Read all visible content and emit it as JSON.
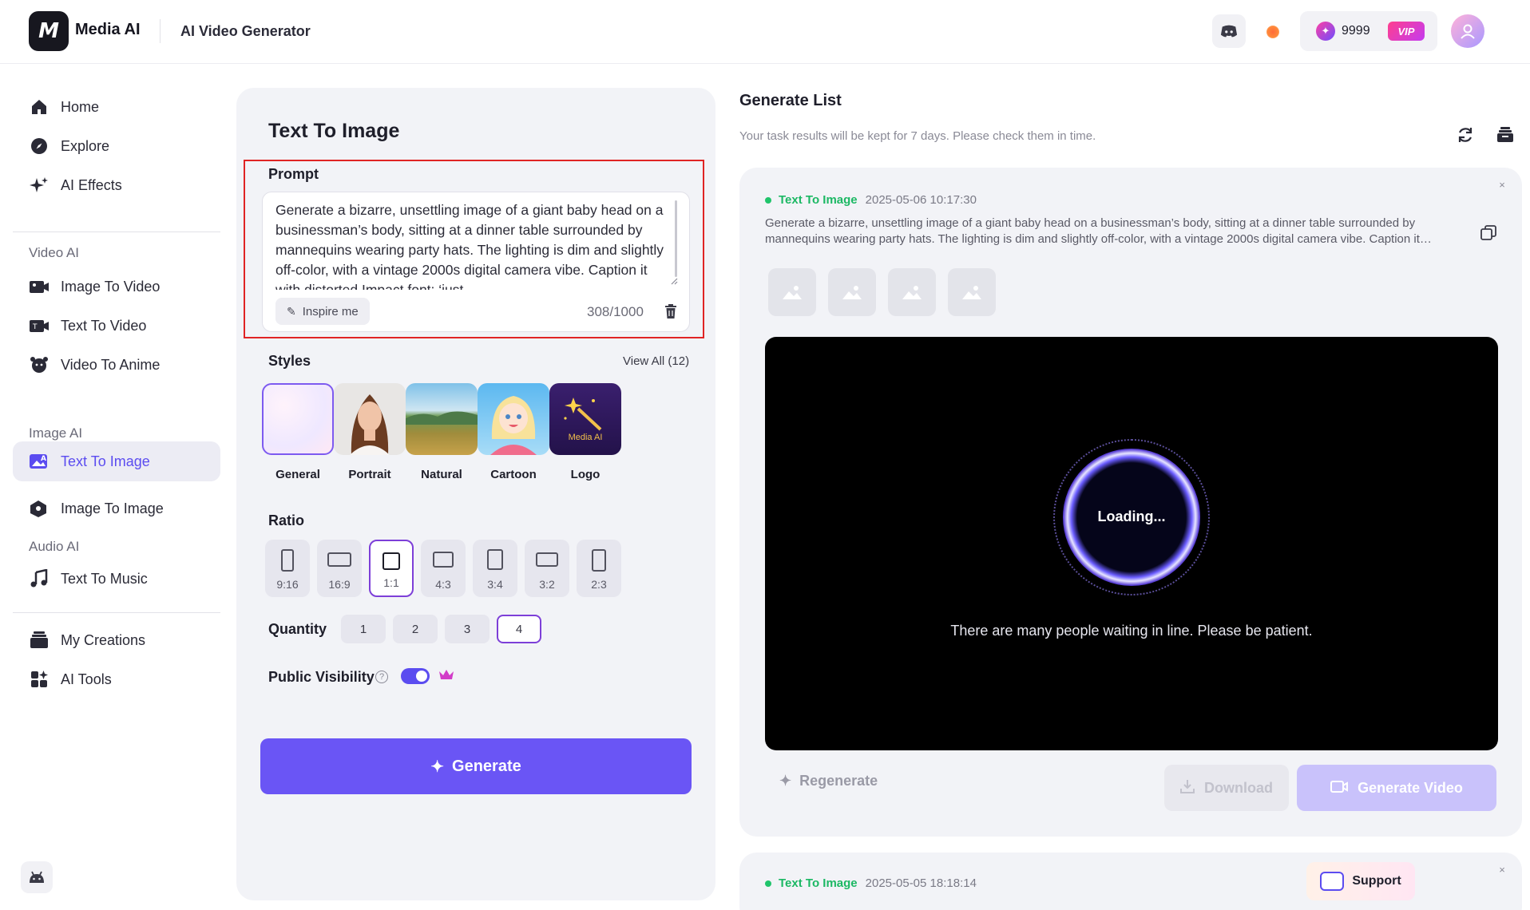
{
  "header": {
    "logo_glyph": "M",
    "brand": "Media AI",
    "title": "AI Video Generator",
    "credits": "9999",
    "vip_label": "VIP"
  },
  "sidebar": {
    "items_top": [
      {
        "label": "Home",
        "icon": "home-icon"
      },
      {
        "label": "Explore",
        "icon": "compass-icon"
      },
      {
        "label": "AI Effects",
        "icon": "sparkle-icon"
      }
    ],
    "section_video": "Video AI",
    "video_items": [
      {
        "label": "Image To Video",
        "icon": "image-video-icon"
      },
      {
        "label": "Text To Video",
        "icon": "text-video-icon"
      },
      {
        "label": "Video To Anime",
        "icon": "anime-icon"
      }
    ],
    "section_image": "Image AI",
    "image_items": [
      {
        "label": "Text To Image",
        "icon": "text-image-icon",
        "active": true
      },
      {
        "label": "Image To Image",
        "icon": "image-image-icon"
      }
    ],
    "section_audio": "Audio AI",
    "audio_items": [
      {
        "label": "Text To Music",
        "icon": "music-icon"
      }
    ],
    "items_bottom": [
      {
        "label": "My Creations",
        "icon": "creations-icon"
      },
      {
        "label": "AI Tools",
        "icon": "tools-icon"
      }
    ]
  },
  "form": {
    "title": "Text To Image",
    "prompt_label": "Prompt",
    "prompt_value": "Generate a bizarre, unsettling image of a giant baby head on a businessman’s body, sitting at a dinner table surrounded by mannequins wearing party hats. The lighting is dim and slightly off-color, with a vintage 2000s digital camera vibe. Caption it with distorted Impact font: ‘just",
    "inspire_label": "Inspire me",
    "char_count": "308/1000",
    "styles_label": "Styles",
    "view_all": "View All (12)",
    "styles": [
      {
        "name": "General",
        "selected": true
      },
      {
        "name": "Portrait"
      },
      {
        "name": "Natural"
      },
      {
        "name": "Cartoon"
      },
      {
        "name": "Logo",
        "thumb_text": "Media AI"
      }
    ],
    "ratio_label": "Ratio",
    "ratios": [
      {
        "label": "9:16"
      },
      {
        "label": "16:9"
      },
      {
        "label": "1:1",
        "selected": true
      },
      {
        "label": "4:3"
      },
      {
        "label": "3:4"
      },
      {
        "label": "3:2"
      },
      {
        "label": "2:3"
      }
    ],
    "quantity_label": "Quantity",
    "quantities": [
      "1",
      "2",
      "3",
      "4"
    ],
    "quantity_selected": "4",
    "visibility_label": "Public Visibility",
    "visibility_on": true,
    "generate_label": "Generate"
  },
  "list": {
    "title": "Generate List",
    "subtitle": "Your task results will be kept for 7 days. Please check them in time.",
    "tasks": [
      {
        "type": "Text To Image",
        "date": "2025-05-06 10:17:30",
        "prompt": "Generate a bizarre, unsettling image of a giant baby head on a businessman’s body, sitting at a dinner table surrounded by mannequins wearing party hats. The lighting is dim and slightly off-color, with a vintage 2000s digital camera vibe. Caption it…",
        "loading_label": "Loading...",
        "waiting_message": "There are many people waiting in line. Please be patient.",
        "regenerate_label": "Regenerate",
        "download_label": "Download",
        "generate_video_label": "Generate Video"
      },
      {
        "type": "Text To Image",
        "date": "2025-05-05 18:18:14"
      }
    ],
    "support_label": "Support"
  },
  "colors": {
    "accent": "#6a55f5",
    "accent_light": "#c9c2fb",
    "status_green": "#20c46b",
    "highlight_red": "#e02424"
  }
}
